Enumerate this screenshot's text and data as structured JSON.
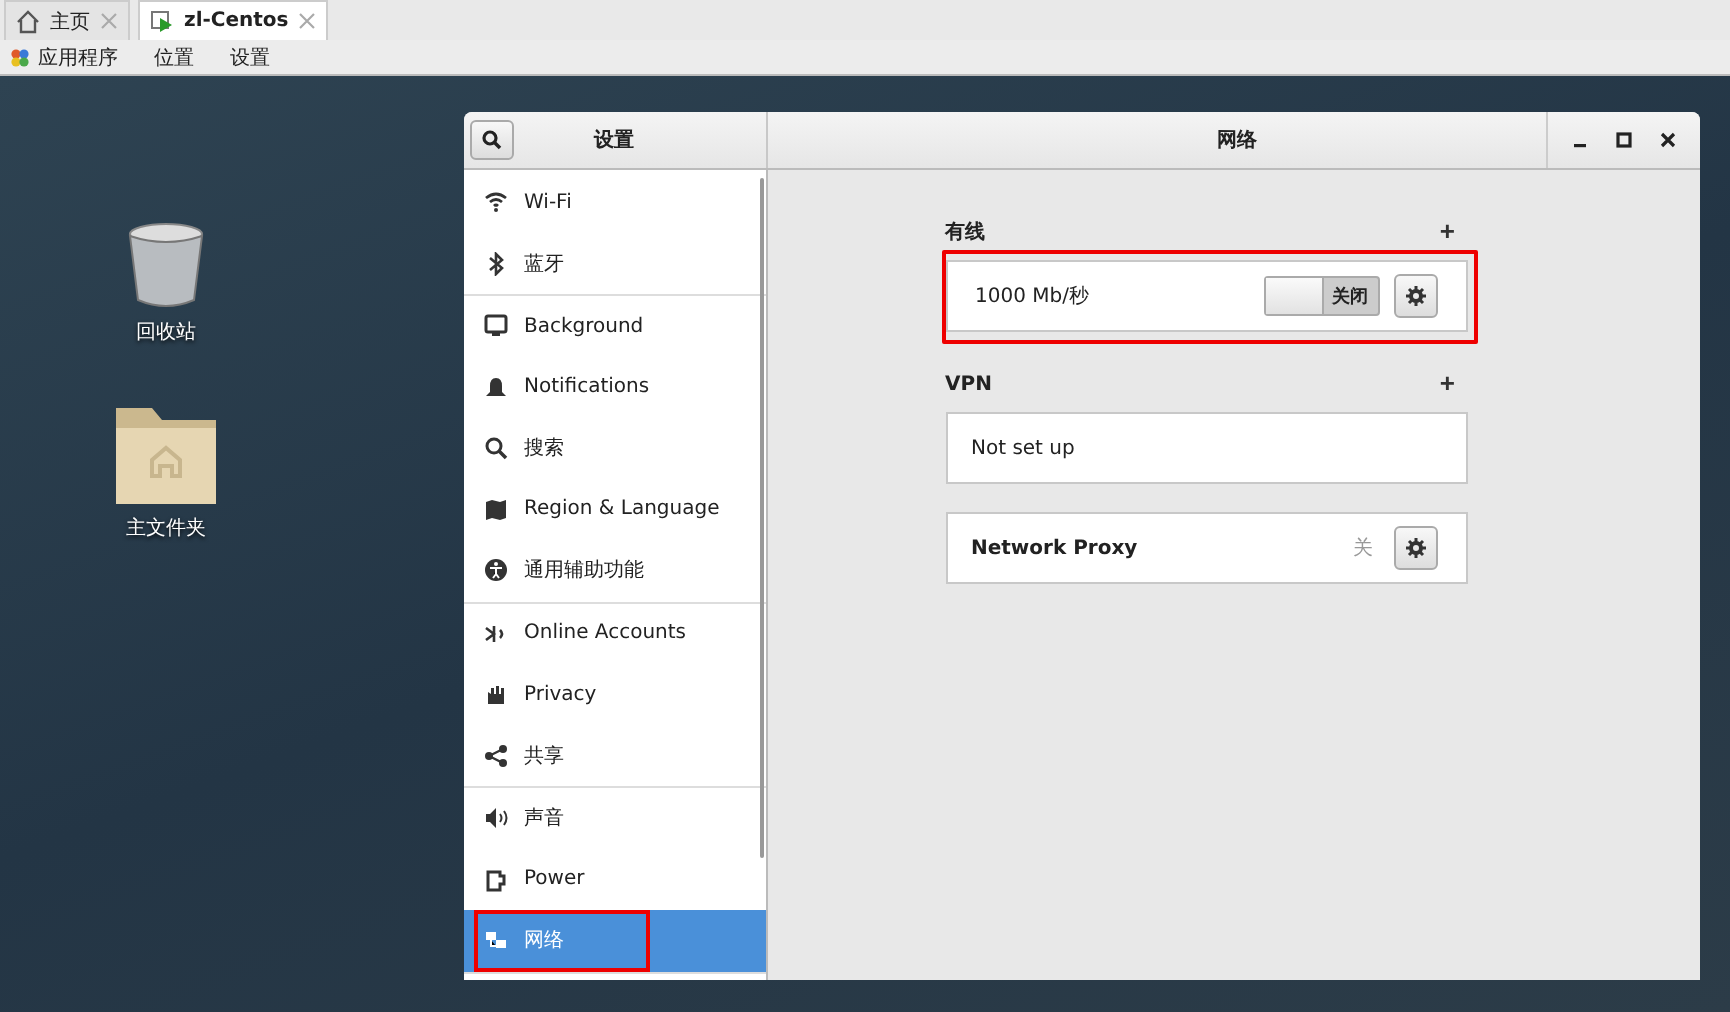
{
  "host_tabs": [
    {
      "label": "主页",
      "selected": false
    },
    {
      "label": "zl-Centos",
      "selected": true
    }
  ],
  "host_menu": [
    "应用程序",
    "位置",
    "设置"
  ],
  "desktop_icons": [
    {
      "label": "回收站",
      "kind": "trash"
    },
    {
      "label": "主文件夹",
      "kind": "folder"
    }
  ],
  "window": {
    "sidebar_title": "设置",
    "title": "网络"
  },
  "sidebar": {
    "groups": [
      [
        {
          "label": "Wi-Fi",
          "selected": false,
          "annotated": false
        },
        {
          "label": "蓝牙",
          "selected": false,
          "annotated": false
        }
      ],
      [
        {
          "label": "Background",
          "selected": false,
          "annotated": false
        },
        {
          "label": "Notifications",
          "selected": false,
          "annotated": false
        },
        {
          "label": "搜索",
          "selected": false,
          "annotated": false
        },
        {
          "label": "Region & Language",
          "selected": false,
          "annotated": false
        },
        {
          "label": "通用辅助功能",
          "selected": false,
          "annotated": false
        }
      ],
      [
        {
          "label": "Online Accounts",
          "selected": false,
          "annotated": false
        },
        {
          "label": "Privacy",
          "selected": false,
          "annotated": false
        },
        {
          "label": "共享",
          "selected": false,
          "annotated": false
        }
      ],
      [
        {
          "label": "声音",
          "selected": false,
          "annotated": false
        },
        {
          "label": "Power",
          "selected": false,
          "annotated": false
        },
        {
          "label": "网络",
          "selected": true,
          "annotated": true
        }
      ]
    ]
  },
  "sections": [
    {
      "heading": "有线",
      "add": "+",
      "annotated": true,
      "rows": [
        {
          "kind": "switch",
          "label": "1000 Mb/秒",
          "switch_label": "关闭",
          "on": false
        }
      ]
    },
    {
      "heading": "VPN",
      "add": "+",
      "annotated": false,
      "rows": [
        {
          "kind": "empty",
          "label": "Not set up"
        }
      ]
    },
    {
      "annotated": false,
      "rows": [
        {
          "kind": "status",
          "label": "Network Proxy",
          "status": "关"
        }
      ]
    }
  ]
}
